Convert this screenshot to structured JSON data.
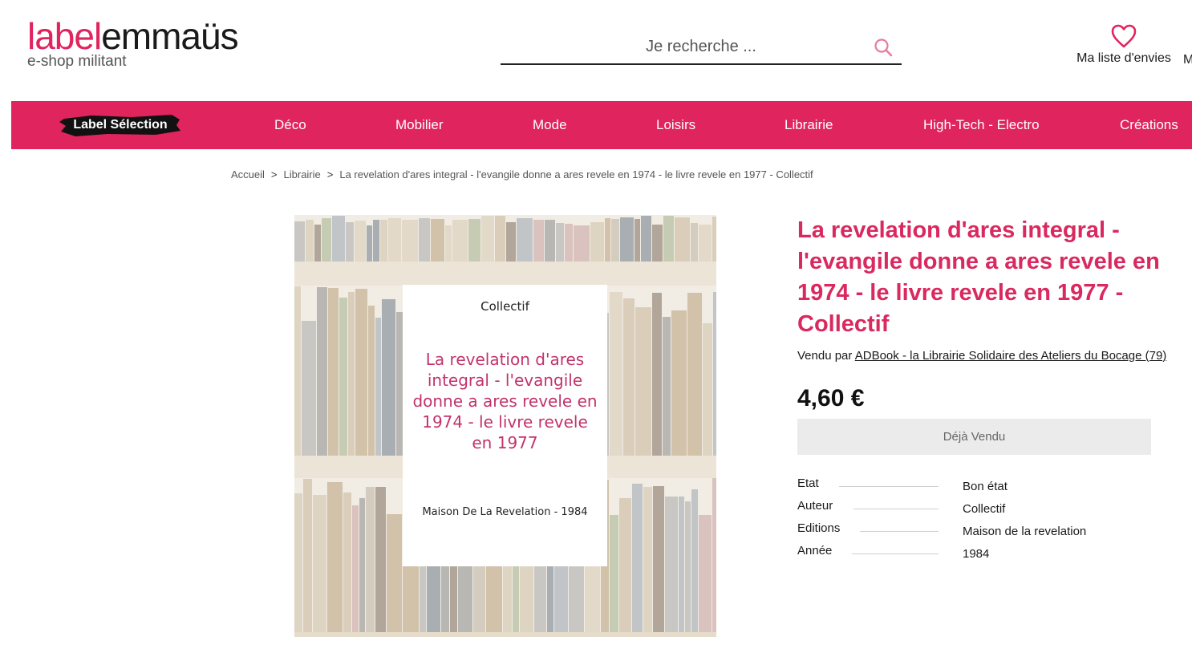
{
  "header": {
    "logo_part1": "label",
    "logo_part2": "emmaüs",
    "logo_tagline": "e-shop militant",
    "search_placeholder": "Je recherche ...",
    "wishlist_label": "Ma liste d'envies",
    "extra_cut_label": "M"
  },
  "nav": {
    "label_selection": "Label Sélection",
    "items": [
      "Déco",
      "Mobilier",
      "Mode",
      "Loisirs",
      "Librairie",
      "High-Tech - Electro",
      "Créations"
    ]
  },
  "breadcrumb": {
    "home": "Accueil",
    "category": "Librairie",
    "current": "La revelation d'ares integral - l'evangile donne a ares revele en 1974 - le livre revele en 1977 - Collectif",
    "separator": ">"
  },
  "cover": {
    "author": "Collectif",
    "title": "La revelation d'ares integral - l'evangile donne a ares revele en 1974 - le livre revele en 1977",
    "publisher_year": "Maison De La Revelation - 1984"
  },
  "product": {
    "title": "La revelation d'ares integral - l'evangile donne a ares revele en 1974 - le livre revele en 1977 - Collectif",
    "sold_by_prefix": "Vendu par",
    "seller": "ADBook - la Librairie Solidaire des Ateliers du Bocage (79)",
    "price": "4,60 €",
    "status_button": "Déjà Vendu",
    "specs": [
      {
        "label": "Etat",
        "value": "Bon état"
      },
      {
        "label": "Auteur",
        "value": "Collectif"
      },
      {
        "label": "Editions",
        "value": "Maison de la revelation"
      },
      {
        "label": "Année",
        "value": "1984"
      }
    ]
  },
  "colors": {
    "brand_pink": "#e0245e",
    "title_pink": "#d9295f",
    "button_gray": "#ebebeb"
  }
}
